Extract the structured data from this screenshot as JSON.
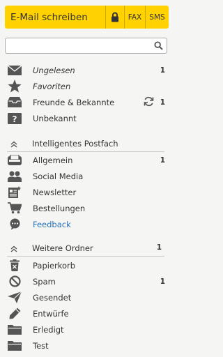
{
  "compose": {
    "write_email_label": "E-Mail schreiben",
    "fax_label": "FAX",
    "sms_label": "SMS"
  },
  "search": {
    "placeholder": "",
    "value": ""
  },
  "folders": [
    {
      "label": "Ungelesen",
      "count": "1",
      "icon": "envelope-icon"
    },
    {
      "label": "Favoriten",
      "count": "",
      "icon": "star-icon"
    },
    {
      "label": "Freunde & Bekannte",
      "count": "1",
      "icon": "inbox-tray-icon"
    },
    {
      "label": "Unbekannt",
      "count": "",
      "icon": "unknown-sender-icon"
    }
  ],
  "smart_inbox": {
    "label": "Intelligentes Postfach",
    "items": [
      {
        "label": "Allgemein",
        "count": "1",
        "icon": "tray-icon"
      },
      {
        "label": "Social Media",
        "count": "",
        "icon": "people-icon"
      },
      {
        "label": "Newsletter",
        "count": "",
        "icon": "newsletter-icon"
      },
      {
        "label": "Bestellungen",
        "count": "",
        "icon": "cart-icon"
      },
      {
        "label": "Feedback",
        "count": "",
        "icon": "speech-bubble-icon"
      }
    ]
  },
  "more_folders": {
    "label": "Weitere Ordner",
    "count": "1",
    "items": [
      {
        "label": "Papierkorb",
        "count": "",
        "icon": "trash-icon"
      },
      {
        "label": "Spam",
        "count": "1",
        "icon": "spam-icon"
      },
      {
        "label": "Gesendet",
        "count": "",
        "icon": "paper-plane-icon"
      },
      {
        "label": "Entwürfe",
        "count": "",
        "icon": "pencil-icon"
      },
      {
        "label": "Erledigt",
        "count": "",
        "icon": "folder-icon"
      },
      {
        "label": "Test",
        "count": "",
        "icon": "folder-icon"
      }
    ]
  }
}
